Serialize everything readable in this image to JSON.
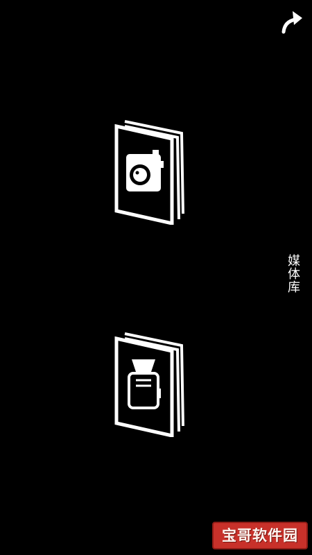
{
  "colors": {
    "background": "#000000",
    "foreground": "#ffffff",
    "watermark_bg": "#c8312a"
  },
  "header": {
    "back_icon": "curved-arrow-up-icon"
  },
  "albums": [
    {
      "icon": "camera-icon"
    },
    {
      "icon": "flash-unit-icon"
    }
  ],
  "sidebar": {
    "label": "媒体库"
  },
  "watermark": {
    "text": "宝哥软件园"
  }
}
